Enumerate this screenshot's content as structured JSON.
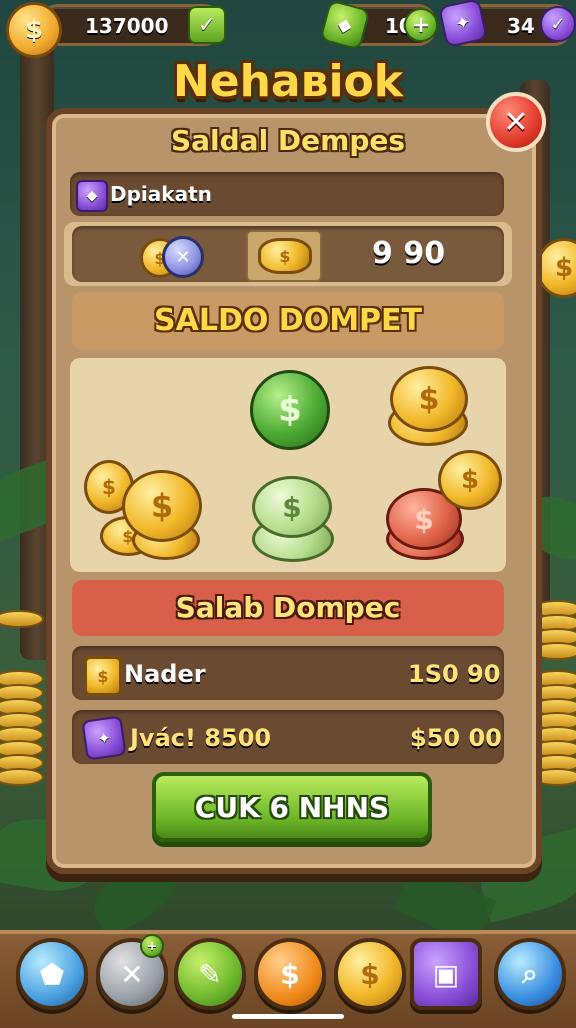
{
  "hud": {
    "coins": "137000",
    "gems": "10",
    "tickets": "34"
  },
  "title": "Nehaвiok",
  "popup": {
    "subtitle": "Saldal Dempes",
    "header_row": "Dpiakatn",
    "balance_row_value": "9 90",
    "banner_top": "SALDO DOMPET",
    "banner_mid": "Salab Dompec",
    "rows": [
      {
        "label": "Nader",
        "value": "1S0 90"
      },
      {
        "label": "Jvác! 8500",
        "value": "$50 00"
      }
    ],
    "cta": "CUK 6 NHNS"
  },
  "icons": {
    "coin_symbol": "$",
    "close_symbol": "✕",
    "plus_symbol": "+"
  },
  "colors": {
    "accent_gold": "#ffd84a",
    "panel": "#b8946a",
    "cta_green": "#6cb428",
    "banner_red": "#d8604a"
  }
}
